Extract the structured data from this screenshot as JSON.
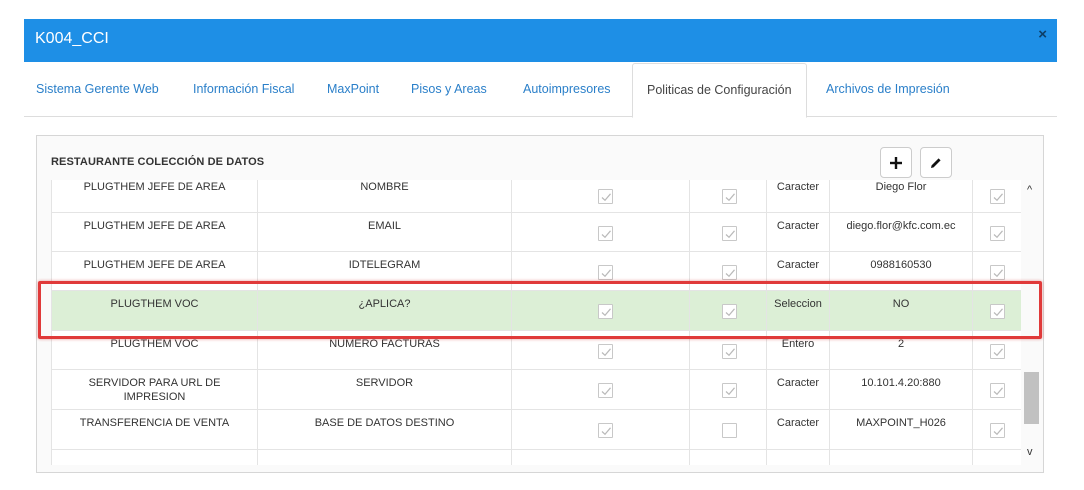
{
  "window": {
    "title": "K004_CCI",
    "close_glyph": "×"
  },
  "tabs": [
    {
      "label": "Sistema Gerente Web"
    },
    {
      "label": "Información Fiscal"
    },
    {
      "label": "MaxPoint"
    },
    {
      "label": "Pisos y Areas"
    },
    {
      "label": "Autoimpresores"
    },
    {
      "label": "Politicas de Configuración",
      "active": true
    },
    {
      "label": "Archivos de Impresión"
    }
  ],
  "panel": {
    "title": "RESTAURANTE COLECCIÓN DE DATOS",
    "buttons": [
      {
        "icon": "plus-icon"
      },
      {
        "icon": "pencil-icon"
      }
    ]
  },
  "rows": [
    {
      "coleccion": "PLUGTHEM JEFE DE AREA",
      "parametro": "NOMBRE",
      "check1": true,
      "check2": true,
      "tipo": "Caracter",
      "valor": "Diego Flor",
      "check3": true
    },
    {
      "coleccion": "PLUGTHEM JEFE DE AREA",
      "parametro": "EMAIL",
      "check1": true,
      "check2": true,
      "tipo": "Caracter",
      "valor": "diego.flor@kfc.com.ec",
      "check3": true
    },
    {
      "coleccion": "PLUGTHEM JEFE DE AREA",
      "parametro": "IDTELEGRAM",
      "check1": true,
      "check2": true,
      "tipo": "Caracter",
      "valor": "0988160530",
      "check3": true
    },
    {
      "coleccion": "PLUGTHEM VOC",
      "parametro": "¿APLICA?",
      "check1": true,
      "check2": true,
      "tipo": "Seleccion",
      "valor": "NO",
      "check3": true,
      "selected": true
    },
    {
      "coleccion": "PLUGTHEM VOC",
      "parametro": "NUMERO FACTURAS",
      "check1": true,
      "check2": true,
      "tipo": "Entero",
      "valor": "2",
      "check3": true
    },
    {
      "coleccion": "SERVIDOR PARA URL DE IMPRESION",
      "parametro": "SERVIDOR",
      "check1": true,
      "check2": true,
      "tipo": "Caracter",
      "valor": "10.101.4.20:880",
      "check3": true
    },
    {
      "coleccion": "TRANSFERENCIA DE VENTA",
      "parametro": "BASE DE DATOS DESTINO",
      "check1": true,
      "check2": false,
      "tipo": "Caracter",
      "valor": "MAXPOINT_H026",
      "check3": true
    },
    {
      "coleccion": "",
      "parametro": "",
      "check1": false,
      "check2": false,
      "tipo": "",
      "valor": "",
      "check3": false
    }
  ],
  "scrollbar": {
    "up_glyph": "^",
    "down_glyph": "v"
  },
  "colors": {
    "header": "#1e8fe6",
    "tab_link": "#2a7fc9",
    "selected_row": "#dcefd6",
    "highlight_box": "#e03a3a"
  }
}
